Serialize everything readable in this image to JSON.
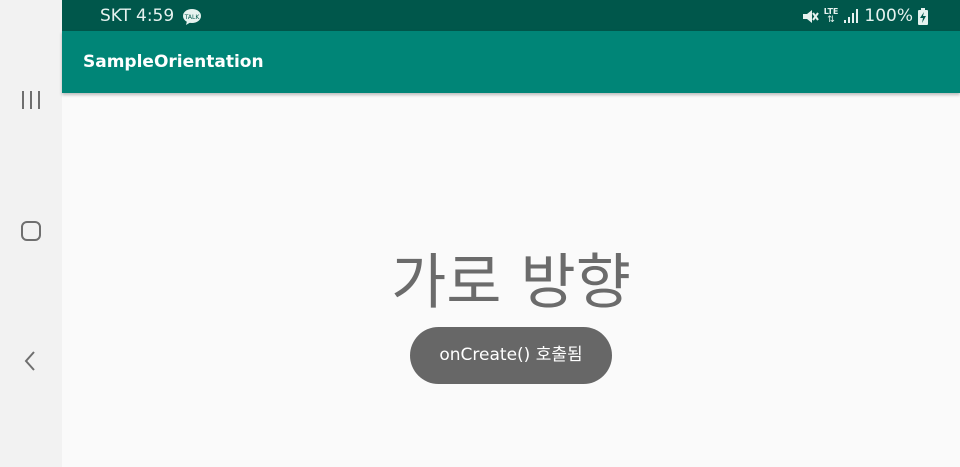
{
  "status_bar": {
    "carrier": "SKT",
    "time": "4:59",
    "network": "LTE",
    "battery": "100%",
    "icons": [
      "kakaotalk-notification-icon",
      "mute-icon",
      "lte-icon",
      "signal-icon",
      "battery-charging-icon"
    ]
  },
  "app_bar": {
    "title": "SampleOrientation"
  },
  "content": {
    "text": "가로 방향"
  },
  "toast": {
    "text": "onCreate() 호출됨"
  },
  "navigation": {
    "buttons": [
      "recent-apps-icon",
      "home-icon",
      "back-icon"
    ]
  },
  "colors": {
    "status_bar": "#00574b",
    "app_bar": "#008577",
    "background": "#fafafa",
    "nav_bar": "#f2f2f2",
    "toast": "#676767",
    "text_gray": "#6b6b6b"
  }
}
